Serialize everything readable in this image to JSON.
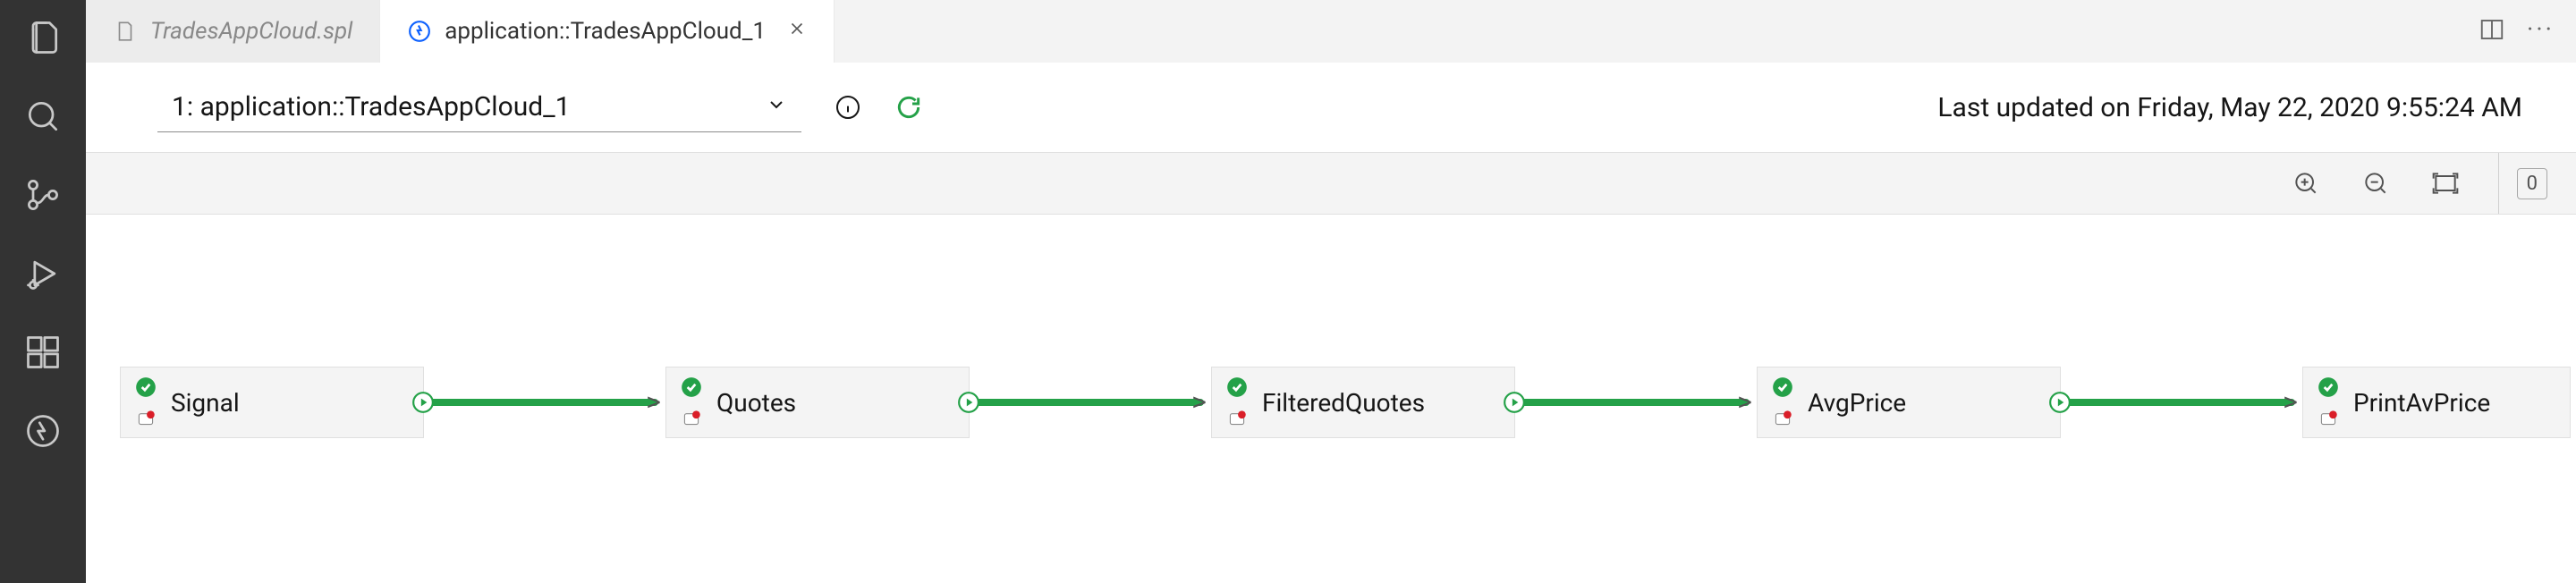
{
  "tabs": {
    "inactive_label": "TradesAppCloud.spl",
    "active_label": "application::TradesAppCloud_1"
  },
  "selector": {
    "label": "1: application::TradesAppCloud_1"
  },
  "timestamp": "Last updated on Friday, May 22, 2020 9:55:24 AM",
  "toolbar": {
    "counter": "0"
  },
  "nodes": [
    {
      "label": "Signal"
    },
    {
      "label": "Quotes"
    },
    {
      "label": "FilteredQuotes"
    },
    {
      "label": "AvgPrice"
    },
    {
      "label": "PrintAvPrice"
    }
  ]
}
